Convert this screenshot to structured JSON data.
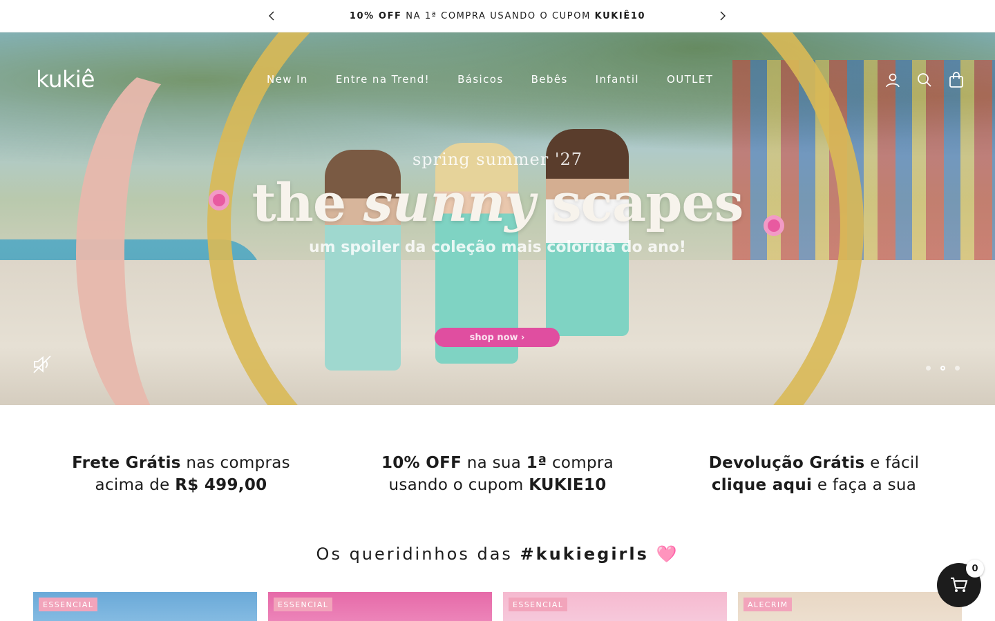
{
  "announcement": {
    "bold_1": "10% OFF",
    "middle": " NA 1ª COMPRA USANDO O CUPOM ",
    "bold_2": "KUKIÊ10"
  },
  "header": {
    "logo": "kukiê",
    "nav": [
      {
        "label": "New In"
      },
      {
        "label": "Entre na Trend!"
      },
      {
        "label": "Básicos"
      },
      {
        "label": "Bebês"
      },
      {
        "label": "Infantil"
      },
      {
        "label": "OUTLET"
      }
    ],
    "icons": [
      "account-icon",
      "search-icon",
      "bag-icon"
    ]
  },
  "hero": {
    "kicker": "spring summer '27",
    "title_part1": "the ",
    "title_part2": "sunny",
    "title_part3": " scapes",
    "subtitle": "um spoiler da coleção mais colorida do ano!",
    "cta": "shop now ›",
    "slides_total": 3,
    "active_slide": 2
  },
  "benefits": [
    {
      "bold": "Frete Grátis",
      "text1": " nas compras",
      "text2": "acima de ",
      "bold2": "R$ 499,00"
    },
    {
      "bold": "10% OFF",
      "text1": "  na sua ",
      "bold_mid": "1ª",
      "text1b": " compra",
      "text2": "usando o cupom ",
      "bold2": "KUKIE10"
    },
    {
      "bold": "Devolução Grátis",
      "text1": "  e fácil",
      "bold2": "clique aqui",
      "text2": " e  faça a sua"
    }
  ],
  "section": {
    "title_text": "Os queridinhos das ",
    "title_bold": "#kukiegirls",
    "heart": "🩷"
  },
  "products": [
    {
      "tag": "ESSENCIAL",
      "color": "#6aa9d8"
    },
    {
      "tag": "ESSENCIAL",
      "color": "#e66aa8"
    },
    {
      "tag": "ESSENCIAL",
      "color": "#f5b9cf"
    },
    {
      "tag": "ALECRIM",
      "color": "#e8d7c4"
    }
  ],
  "cart": {
    "count": "0"
  }
}
